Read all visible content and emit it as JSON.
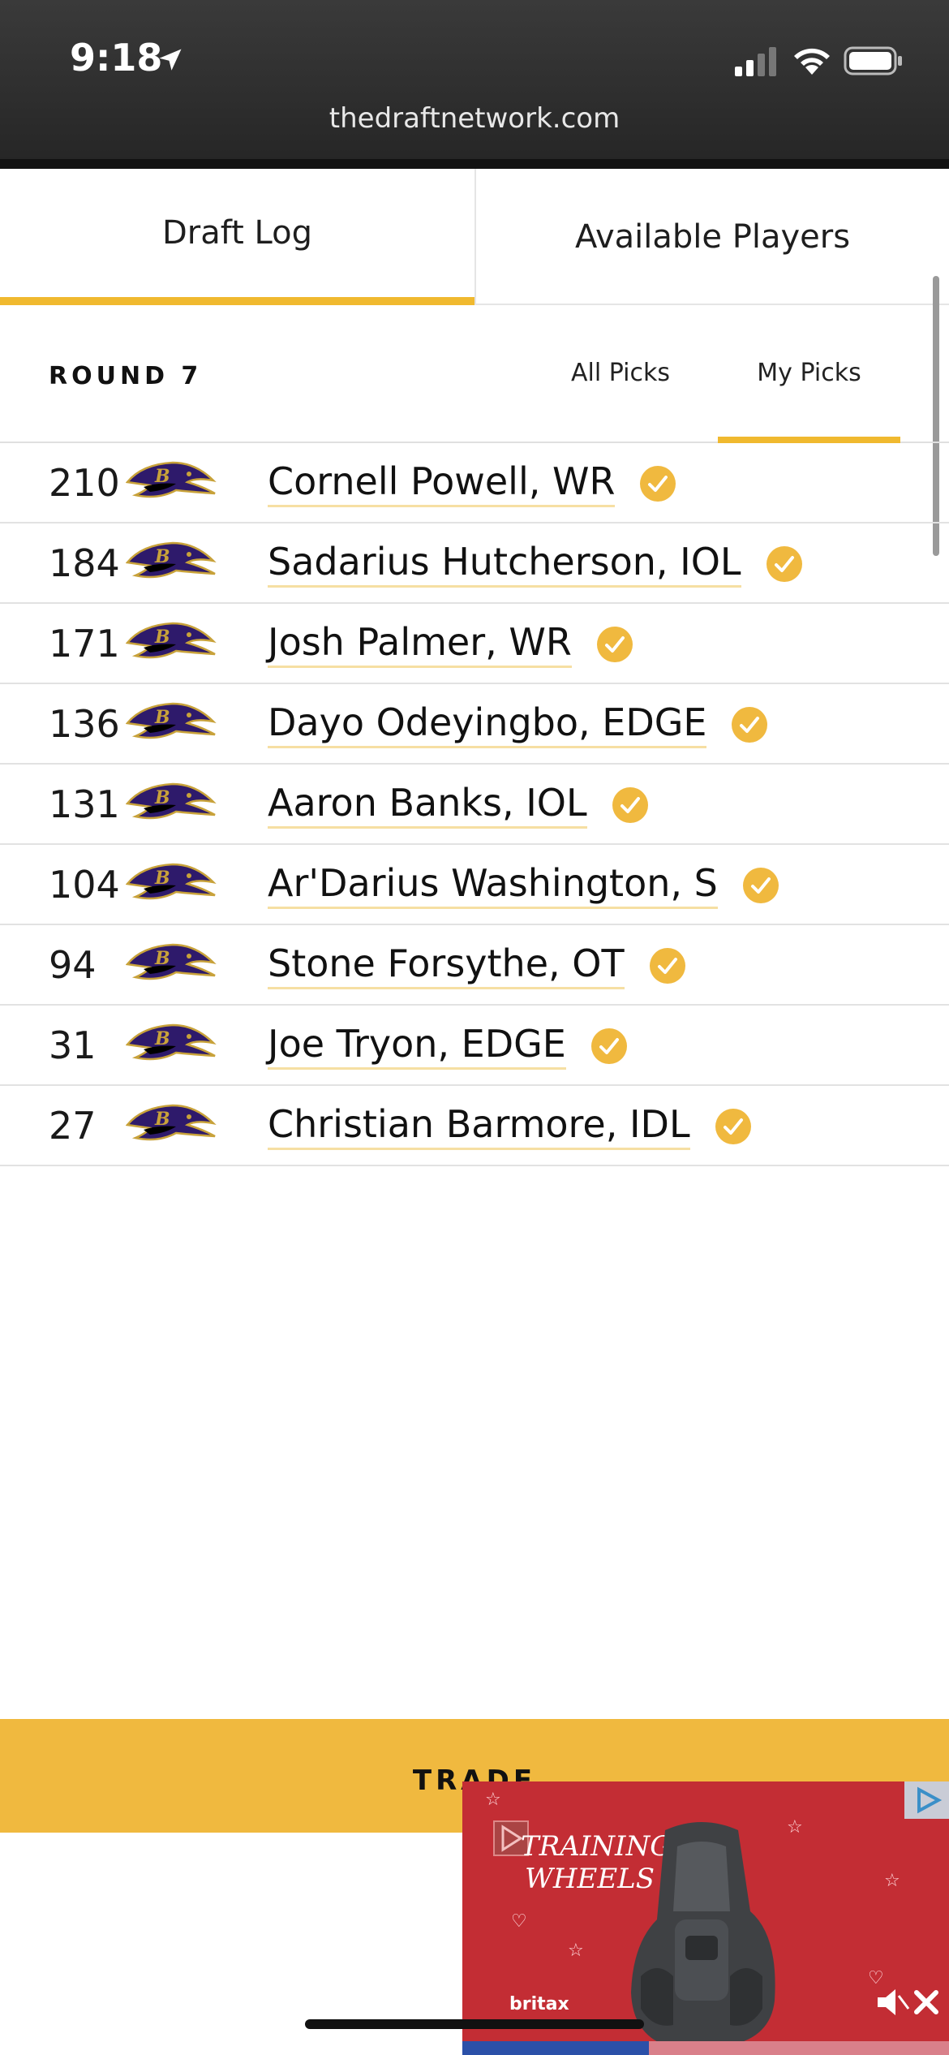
{
  "status_bar": {
    "time": "9:18",
    "url": "thedraftnetwork.com"
  },
  "tabs": [
    {
      "label": "Draft Log",
      "active": true
    },
    {
      "label": "Available Players",
      "active": false
    }
  ],
  "round": {
    "title": "ROUND 7"
  },
  "filters": {
    "all": "All Picks",
    "mine": "My Picks",
    "selected": "My Picks"
  },
  "team": {
    "logo": "ravens-logo"
  },
  "picks": [
    {
      "number": "210",
      "player": "Cornell Powell, WR"
    },
    {
      "number": "184",
      "player": "Sadarius Hutcherson, IOL"
    },
    {
      "number": "171",
      "player": "Josh Palmer, WR"
    },
    {
      "number": "136",
      "player": "Dayo Odeyingbo, EDGE"
    },
    {
      "number": "131",
      "player": "Aaron Banks, IOL"
    },
    {
      "number": "104",
      "player": "Ar'Darius Washington, S"
    },
    {
      "number": "94",
      "player": "Stone Forsythe, OT"
    },
    {
      "number": "31",
      "player": "Joe Tryon, EDGE"
    },
    {
      "number": "27",
      "player": "Christian Barmore, IDL"
    }
  ],
  "trade": {
    "label": "TRADE"
  },
  "ad": {
    "title": "TRAINING WHEELS",
    "brand": "britax"
  },
  "colors": {
    "accent": "#f0b92f",
    "ad_background": "#c32d34"
  }
}
